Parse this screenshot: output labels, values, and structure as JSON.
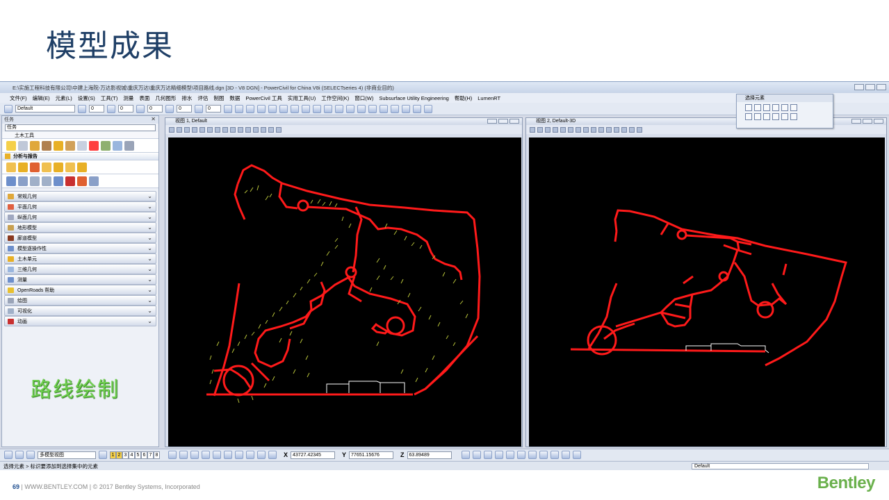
{
  "slide": {
    "title": "模型成果",
    "caption": "路线绘制",
    "footer": {
      "page": "69",
      "site": "WWW.BENTLEY.COM",
      "copyright": "© 2017 Bentley Systems, Incorporated"
    },
    "logo": "Bentley"
  },
  "app": {
    "window_title": "E:\\实施工程科技有限公司\\中建上海院-万达影视城\\重庆万达\\重庆万达精细模型\\项目路线.dgn [3D - V8 DGN] - PowerCivil for China V8i (SELECTseries 4) (非商业目的)",
    "menu": [
      "文件(F)",
      "编辑(E)",
      "元素(L)",
      "设置(S)",
      "工具(T)",
      "测量",
      "表面",
      "几何图形",
      "排水",
      "评估",
      "制图",
      "数据",
      "PowerCivil 工具",
      "实用工具(U)",
      "工作空间(K)",
      "窗口(W)",
      "Subsurface Utility Engineering",
      "帮助(H)",
      "LumenRT"
    ],
    "toolbar": {
      "level": "Default",
      "weight1": "0",
      "weight2": "0",
      "weight3": "0",
      "weight4": "0",
      "weight5": "0"
    },
    "task_panel": {
      "header": "任务",
      "selector": "任务",
      "sub": "土木工具",
      "section": "分析与报告",
      "items": [
        "常规几何",
        "平面几何",
        "纵面几何",
        "地形模型",
        "廊道模型",
        "模型逐操作性",
        "土木单元",
        "三维几何",
        "测量",
        "OpenRoads 帮助",
        "绘图",
        "可视化",
        "动画"
      ]
    },
    "views": [
      {
        "title": "视图 1, Default"
      },
      {
        "title": "视图 2, Default-3D"
      }
    ],
    "select_box": {
      "title": "选择元素"
    },
    "bottom": {
      "model": "多模型视图",
      "pages": [
        "1",
        "2",
        "3",
        "4",
        "5",
        "6",
        "7",
        "8"
      ],
      "x_label": "X",
      "x": "43727.42345",
      "y_label": "Y",
      "y": "77651.15676",
      "z_label": "Z",
      "z": "63.89489"
    },
    "status": {
      "prompt": "选择元素 > 标识要添加到选择集中的元素",
      "level": "Default"
    }
  },
  "colors": {
    "title": "#1f3f66",
    "caption": "#6fcf4f",
    "route": "#ff1a1a",
    "canvas": "#000000"
  }
}
